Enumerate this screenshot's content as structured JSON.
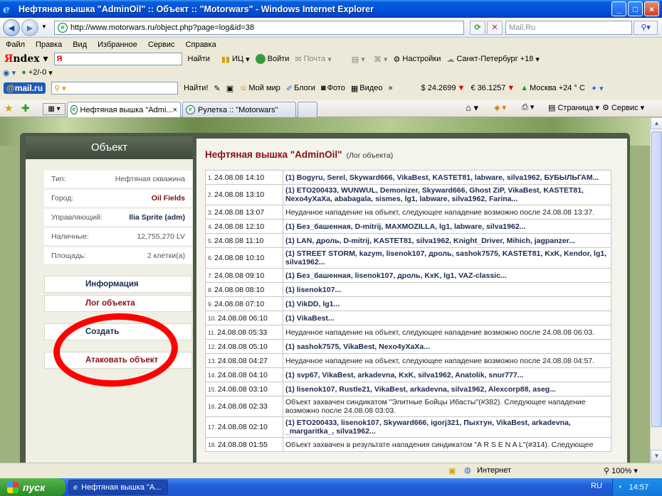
{
  "window": {
    "title": "Нефтяная вышка \"AdminOil\" :: Объект :: \"Motorwars\" - Windows Internet Explorer",
    "min": "_",
    "max": "□",
    "close": "×"
  },
  "address": {
    "url": "http://www.motorwars.ru/object.php?page=log&id=38",
    "search_value": "Mail.Ru"
  },
  "menu": [
    "Файл",
    "Правка",
    "Вид",
    "Избранное",
    "Сервис",
    "Справка"
  ],
  "yandex_bar": {
    "logo_first": "Я",
    "logo_rest": "ndex",
    "search_value": "Я",
    "find": "Найти",
    "ic": "ИЦ",
    "login": "Войти",
    "mail": "Почта",
    "settings": "Настройки",
    "weather": "Санкт-Петербург +18"
  },
  "counter_bar": {
    "counter": "+2/-0"
  },
  "mailru_bar": {
    "logo_at": "@",
    "logo_text": "mail.ru",
    "find": "Найти!",
    "moi_mir": "Мой мир",
    "blogs": "Блоги",
    "photo": "Фото",
    "video": "Видео",
    "more": "»",
    "usd": "$ 24.2699",
    "eur": "€ 36.1257",
    "weather": "Москва +24 ° C"
  },
  "tabs": [
    {
      "label": "Нефтяная вышка \"Admi...",
      "close": "×"
    },
    {
      "label": "Рулетка :: \"Motorwars\""
    }
  ],
  "command_bar": {
    "page": "Страница",
    "tools": "Сервис"
  },
  "left_panel": {
    "header": "Объект",
    "rows": [
      {
        "k": "Тип:",
        "v": "Нефтяная скважина"
      },
      {
        "k": "Город:",
        "v": "Oil Fields"
      },
      {
        "k": "Управляющий:",
        "v": "Ilia Sprite (adm)"
      },
      {
        "k": "Наличные:",
        "v": "12,755,270 LV"
      },
      {
        "k": "Площадь:",
        "v": "2 клетки(а)"
      }
    ],
    "menu": [
      {
        "label": "Информация"
      },
      {
        "label": "Лог объекта"
      },
      {
        "label": "Создать"
      },
      {
        "label": "Атаковать объект"
      }
    ]
  },
  "right_panel": {
    "title": "Нефтяная вышка \"AdminOil\"",
    "subtitle": "(Лог объекта)"
  },
  "log": [
    {
      "n": "1.",
      "date": "24.08.08 14:10",
      "text": "(1) Bogyru, Serel, Skyward666, VikaBest, KASTET81, labware, silva1962, БУБЫЛЬГАМ..."
    },
    {
      "n": "2.",
      "date": "24.08.08 13:10",
      "text": "(1) ETO200433, WUNWUL, Demonizer, Skyward666, Ghost ZiP, VikaBest, KASTET81, Nexo4yXaXa, ababagala, sismes, lg1, labware, silva1962, Farina..."
    },
    {
      "n": "3.",
      "date": "24.08.08 13:07",
      "text": "Неудачное нападение на объект, следующее нападение возможно после 24.08.08 13:37."
    },
    {
      "n": "4.",
      "date": "24.08.08 12:10",
      "text": "(1) Без_башенная, D-mitrij, MAXMOZILLA, lg1, labware, silva1962..."
    },
    {
      "n": "5.",
      "date": "24.08.08 11:10",
      "text": "(1) LAN, дроль, D-mitrij, KASTET81, silva1962, Knight_Driver, Mihich, jagpanzer..."
    },
    {
      "n": "6.",
      "date": "24.08.08 10:10",
      "text": "(1) STREET STORM, kazym, lisenok107, дроль, sashok7575, KASTET81, KxK, Kendor, lg1, silva1962..."
    },
    {
      "n": "7.",
      "date": "24.08.08 09:10",
      "text": "(1) Без_башенная, lisenok107, дроль, KxK, lg1, VAZ-classic..."
    },
    {
      "n": "8.",
      "date": "24.08.08 08:10",
      "text": "(1) lisenok107..."
    },
    {
      "n": "9.",
      "date": "24.08.08 07:10",
      "text": "(1) VikDD, lg1..."
    },
    {
      "n": "10.",
      "date": "24.08.08 06:10",
      "text": "(1) VikaBest..."
    },
    {
      "n": "11.",
      "date": "24.08.08 05:33",
      "text": "Неудачное нападение на объект, следующее нападение возможно после 24.08.08 06:03."
    },
    {
      "n": "12.",
      "date": "24.08.08 05:10",
      "text": "(1) sashok7575, VikaBest, Nexo4yXaXa..."
    },
    {
      "n": "13.",
      "date": "24.08.08 04:27",
      "text": "Неудачное нападение на объект, следующее нападение возможно после 24.08.08 04:57."
    },
    {
      "n": "14.",
      "date": "24.08.08 04:10",
      "text": "(1) svp67, VikaBest, arkadevna, KxK, silva1962, Anatolik, snur777..."
    },
    {
      "n": "15.",
      "date": "24.08.08 03:10",
      "text": "(1) lisenok107, Rustle21, VikaBest, arkadevna, silva1962, Alexcorp88, aseg..."
    },
    {
      "n": "16.",
      "date": "24.08.08 02:33",
      "text": "Объект захвачен синдикатом \"Элитные Бойцы Ибасты\"(#382). Следующее нападение возможно после 24.08.08 03:03."
    },
    {
      "n": "17.",
      "date": "24.08.08 02:10",
      "text": "(1) ETO200433, lisenok107, Skyward666, igorj321, Пыхтун, VikaBest, arkadevna, _margaritka_, silva1962..."
    },
    {
      "n": "18.",
      "date": "24.08.08 01:55",
      "text": "Объект захвачен в результате нападения синдикатом \"A R S E N A L\"(#314). Следующее"
    }
  ],
  "status": {
    "zone": "Интернет",
    "zoom": "100%"
  },
  "taskbar": {
    "start": "пуск",
    "item": "Нефтяная вышка \"A...",
    "lang": "RU",
    "time": "14:57"
  },
  "colors": {
    "title_red": "#8a1010",
    "link_blue": "#1a2a50",
    "frame": "#4e5a49",
    "annotation": "#ff0000"
  }
}
